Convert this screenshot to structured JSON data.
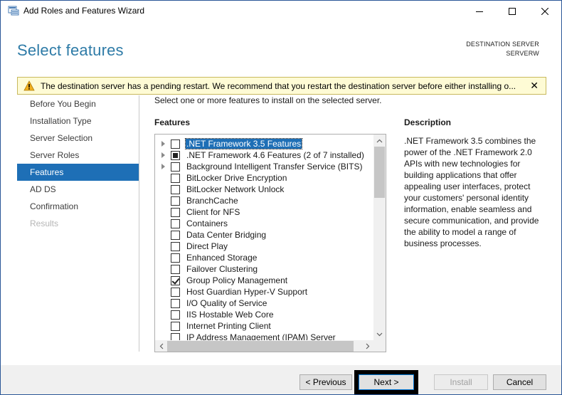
{
  "window": {
    "title": "Add Roles and Features Wizard",
    "minimize": "minimize",
    "maximize": "maximize",
    "close": "close"
  },
  "header": {
    "page_title": "Select features",
    "destination_label": "DESTINATION SERVER",
    "destination_server": "SERVERW"
  },
  "warning": {
    "text": "The destination server has a pending restart. We recommend that you restart the destination server before either installing o...",
    "close_glyph": "✕",
    "icon": "warning-triangle-icon",
    "background": "#fefbd5"
  },
  "nav": {
    "items": [
      {
        "label": "Before You Begin",
        "state": "normal"
      },
      {
        "label": "Installation Type",
        "state": "normal"
      },
      {
        "label": "Server Selection",
        "state": "normal"
      },
      {
        "label": "Server Roles",
        "state": "normal"
      },
      {
        "label": "Features",
        "state": "active"
      },
      {
        "label": "AD DS",
        "state": "normal"
      },
      {
        "label": "Confirmation",
        "state": "normal"
      },
      {
        "label": "Results",
        "state": "disabled"
      }
    ],
    "active_color": "#1e6fb6"
  },
  "main": {
    "instruction": "Select one or more features to install on the selected server.",
    "features_heading": "Features",
    "description_heading": "Description",
    "description_text": ".NET Framework 3.5 combines the power of the .NET Framework 2.0 APIs with new technologies for building applications that offer appealing user interfaces, protect your customers' personal identity information, enable seamless and secure communication, and provide the ability to model a range of business processes.",
    "features": [
      {
        "label": ".NET Framework 3.5 Features",
        "expandable": true,
        "check": "unchecked",
        "selected": true
      },
      {
        "label": ".NET Framework 4.6 Features (2 of 7 installed)",
        "expandable": true,
        "check": "partial",
        "selected": false
      },
      {
        "label": "Background Intelligent Transfer Service (BITS)",
        "expandable": true,
        "check": "unchecked",
        "selected": false
      },
      {
        "label": "BitLocker Drive Encryption",
        "expandable": false,
        "check": "unchecked",
        "selected": false
      },
      {
        "label": "BitLocker Network Unlock",
        "expandable": false,
        "check": "unchecked",
        "selected": false
      },
      {
        "label": "BranchCache",
        "expandable": false,
        "check": "unchecked",
        "selected": false
      },
      {
        "label": "Client for NFS",
        "expandable": false,
        "check": "unchecked",
        "selected": false
      },
      {
        "label": "Containers",
        "expandable": false,
        "check": "unchecked",
        "selected": false
      },
      {
        "label": "Data Center Bridging",
        "expandable": false,
        "check": "unchecked",
        "selected": false
      },
      {
        "label": "Direct Play",
        "expandable": false,
        "check": "unchecked",
        "selected": false
      },
      {
        "label": "Enhanced Storage",
        "expandable": false,
        "check": "unchecked",
        "selected": false
      },
      {
        "label": "Failover Clustering",
        "expandable": false,
        "check": "unchecked",
        "selected": false
      },
      {
        "label": "Group Policy Management",
        "expandable": false,
        "check": "checked",
        "selected": false
      },
      {
        "label": "Host Guardian Hyper-V Support",
        "expandable": false,
        "check": "unchecked",
        "selected": false
      },
      {
        "label": "I/O Quality of Service",
        "expandable": false,
        "check": "unchecked",
        "selected": false
      },
      {
        "label": "IIS Hostable Web Core",
        "expandable": false,
        "check": "unchecked",
        "selected": false
      },
      {
        "label": "Internet Printing Client",
        "expandable": false,
        "check": "unchecked",
        "selected": false
      },
      {
        "label": "IP Address Management (IPAM) Server",
        "expandable": false,
        "check": "unchecked",
        "selected": false
      }
    ]
  },
  "footer": {
    "previous_label": "< Previous",
    "next_label": "Next >",
    "install_label": "Install",
    "cancel_label": "Cancel"
  }
}
